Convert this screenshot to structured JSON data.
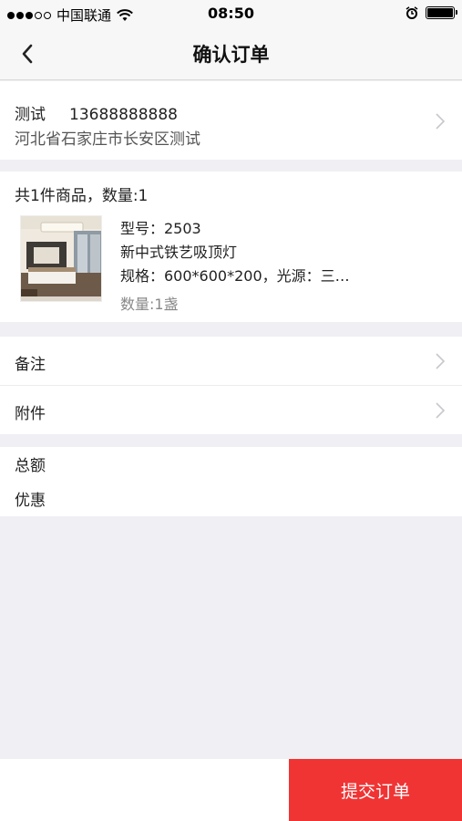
{
  "status": {
    "carrier": "中国联通",
    "time": "08:50"
  },
  "nav": {
    "title": "确认订单"
  },
  "address": {
    "name": "测试",
    "phone": "13688888888",
    "detail": "河北省石家庄市长安区测试"
  },
  "goods": {
    "summary": "共1件商品，数量:1",
    "items": [
      {
        "model": "型号：2503",
        "name": "新中式铁艺吸顶灯",
        "spec": "规格：600*600*200，光源：三…",
        "quantity": "数量:1盏"
      }
    ]
  },
  "options": {
    "remark": "备注",
    "attachment": "附件"
  },
  "totals": {
    "total_label": "总额",
    "discount_label": "优惠"
  },
  "footer": {
    "submit_label": "提交订单"
  },
  "colors": {
    "accent": "#f03434",
    "background": "#efeff4"
  }
}
